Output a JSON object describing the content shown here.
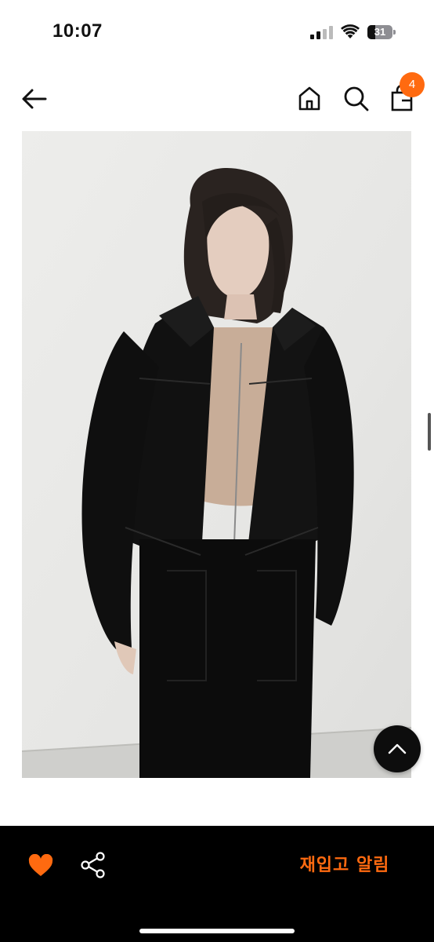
{
  "status_bar": {
    "time": "10:07",
    "battery_level": "31",
    "icons": [
      "cellular-signal-icon",
      "wifi-icon",
      "battery-icon"
    ]
  },
  "header": {
    "icons": [
      "back-arrow-icon",
      "home-icon",
      "search-icon",
      "shopping-bag-icon"
    ],
    "cart_count": "4"
  },
  "product": {
    "image_subject": "Model in black cropped zip-up jacket and black skirt against white wall"
  },
  "floating": {
    "scroll_top_icon": "chevron-up-icon"
  },
  "bottom_bar": {
    "heart_icon": "heart-icon",
    "share_icon": "share-icon",
    "restock_alert_label": "재입고 알림"
  },
  "colors": {
    "accent": "#ff6a10",
    "bottom_bar_bg": "#000000",
    "photo_bg": "#e9e9e7"
  }
}
